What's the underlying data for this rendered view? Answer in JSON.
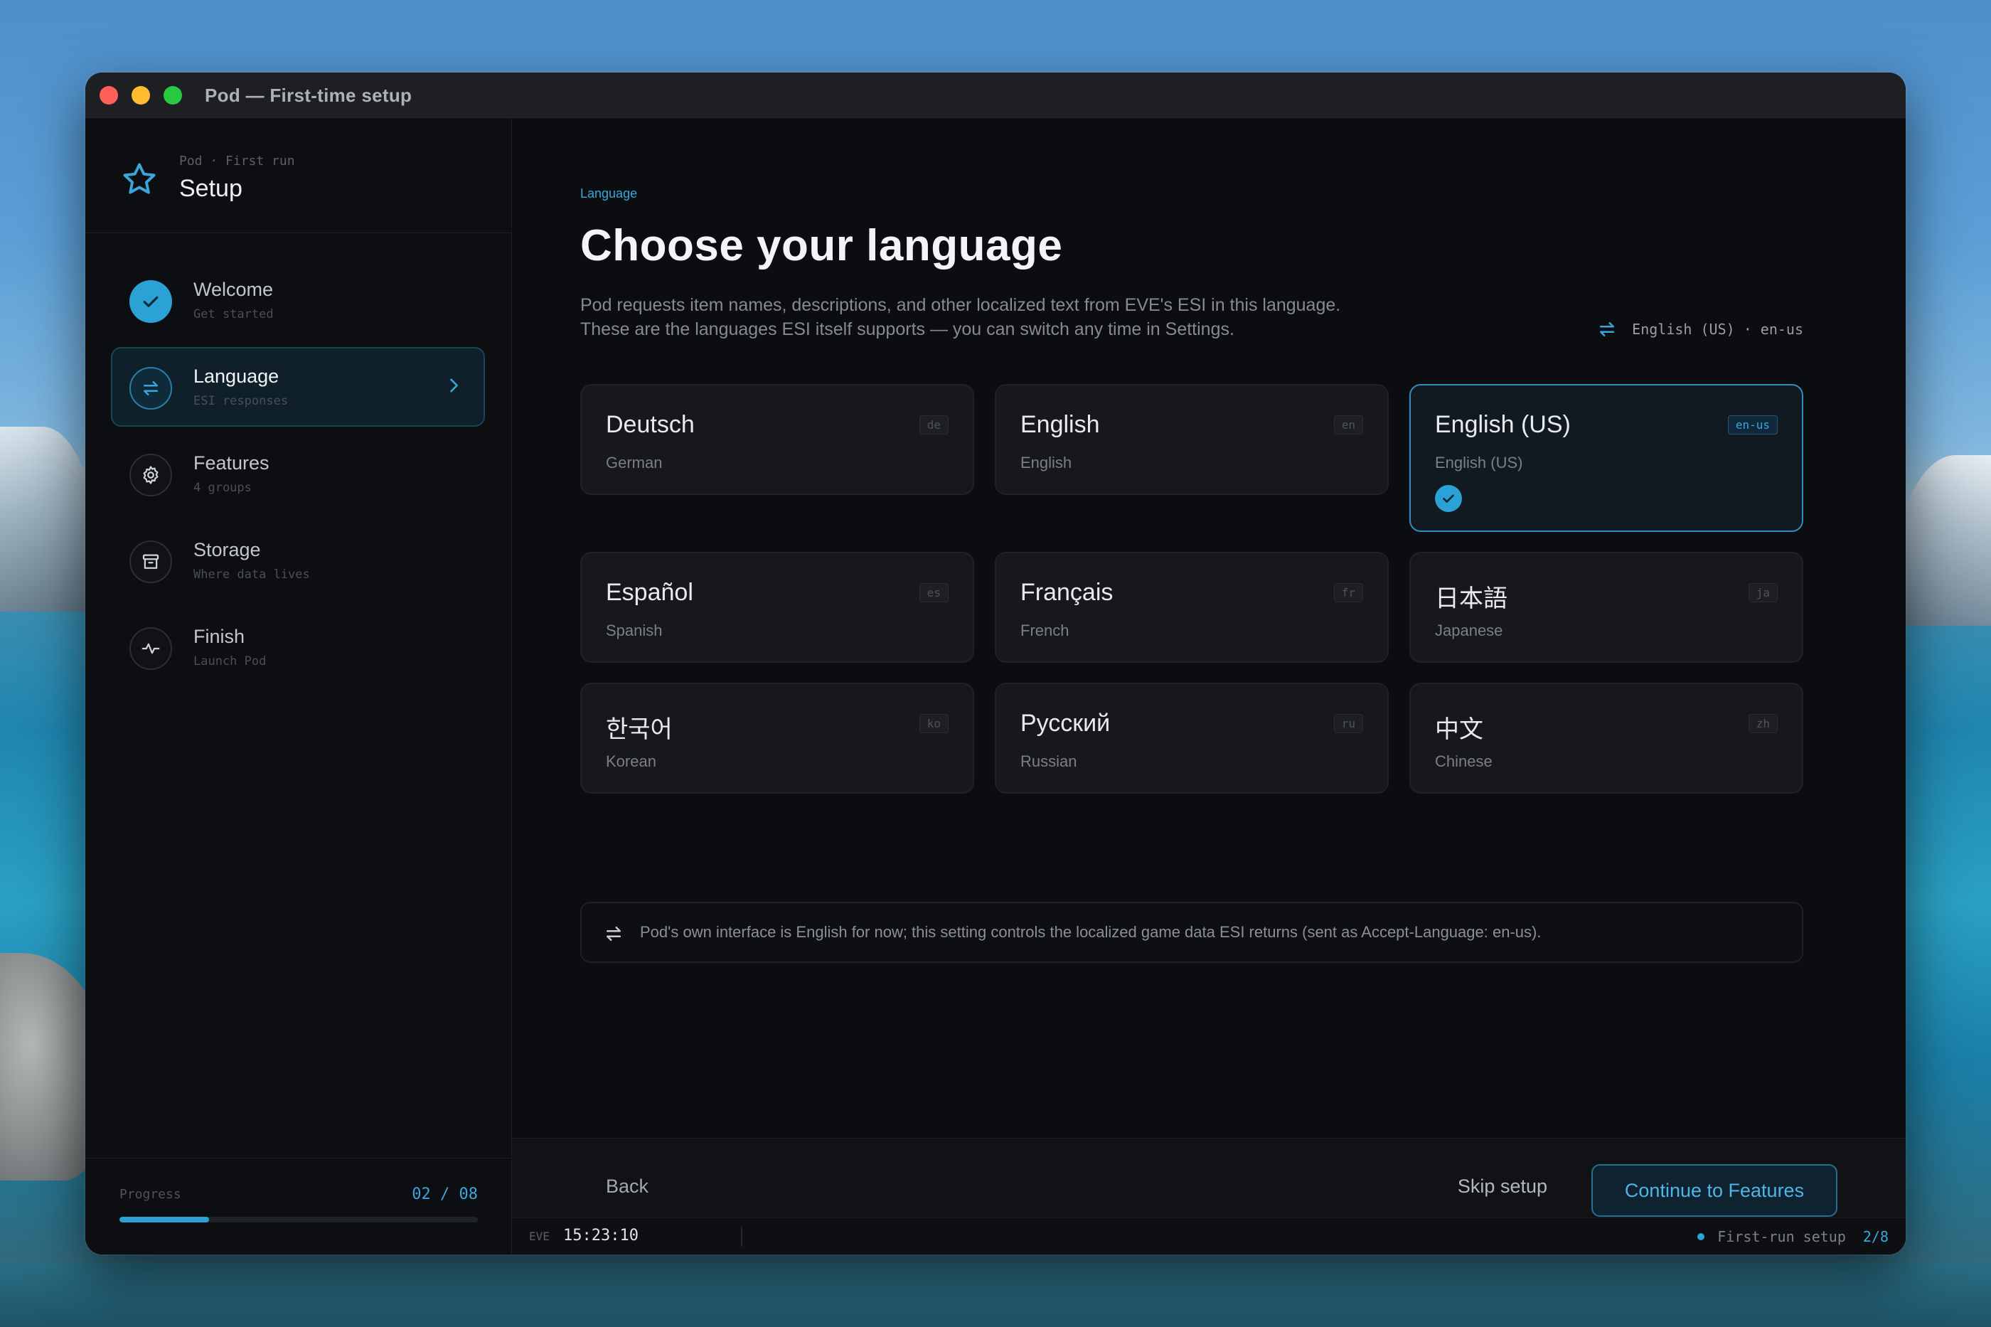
{
  "window": {
    "title": "Pod — First-time setup"
  },
  "brand": {
    "crumb": "Pod · First run",
    "title": "Setup",
    "icon": "star-icon"
  },
  "steps": [
    {
      "title": "Welcome",
      "sub": "Get started",
      "state": "done",
      "icon": "check-icon"
    },
    {
      "title": "Language",
      "sub": "ESI responses",
      "state": "current",
      "icon": "swap-arrows-icon"
    },
    {
      "title": "Features",
      "sub": "4 groups",
      "state": "pending",
      "icon": "gear-icon"
    },
    {
      "title": "Storage",
      "sub": "Where data lives",
      "state": "pending",
      "icon": "archive-icon"
    },
    {
      "title": "Finish",
      "sub": "Launch Pod",
      "state": "pending",
      "icon": "activity-icon"
    }
  ],
  "progress": {
    "label": "Progress",
    "count": "02 / 08",
    "fraction": 0.25
  },
  "main": {
    "eyebrow": "Language",
    "heading": "Choose your language",
    "desc_line1": "Pod requests item names, descriptions, and other localized text from EVE's ESI in this language.",
    "desc_line2": "These are the languages ESI itself supports — you can switch any time in Settings.",
    "current": "English (US) · en-us"
  },
  "languages": [
    {
      "name": "Deutsch",
      "sub": "German",
      "code": "de",
      "selected": false
    },
    {
      "name": "English",
      "sub": "English",
      "code": "en",
      "selected": false
    },
    {
      "name": "English (US)",
      "sub": "English (US)",
      "code": "en-us",
      "selected": true
    },
    {
      "name": "Español",
      "sub": "Spanish",
      "code": "es",
      "selected": false
    },
    {
      "name": "Français",
      "sub": "French",
      "code": "fr",
      "selected": false
    },
    {
      "name": "日本語",
      "sub": "Japanese",
      "code": "ja",
      "selected": false
    },
    {
      "name": "한국어",
      "sub": "Korean",
      "code": "ko",
      "selected": false
    },
    {
      "name": "Русский",
      "sub": "Russian",
      "code": "ru",
      "selected": false
    },
    {
      "name": "中文",
      "sub": "Chinese",
      "code": "zh",
      "selected": false
    }
  ],
  "note": "Pod's own interface is English for now; this setting controls the localized game data ESI returns (sent as Accept-Language: en-us).",
  "footer": {
    "back": "Back",
    "skip": "Skip setup",
    "continue": "Continue to Features"
  },
  "statusbar": {
    "eve_label": "EVE",
    "time": "15:23:10",
    "status": "First-run setup",
    "step": "2/8"
  },
  "colors": {
    "accent": "#2aa2d6",
    "background": "#0c0d10",
    "card": "#17181c"
  }
}
